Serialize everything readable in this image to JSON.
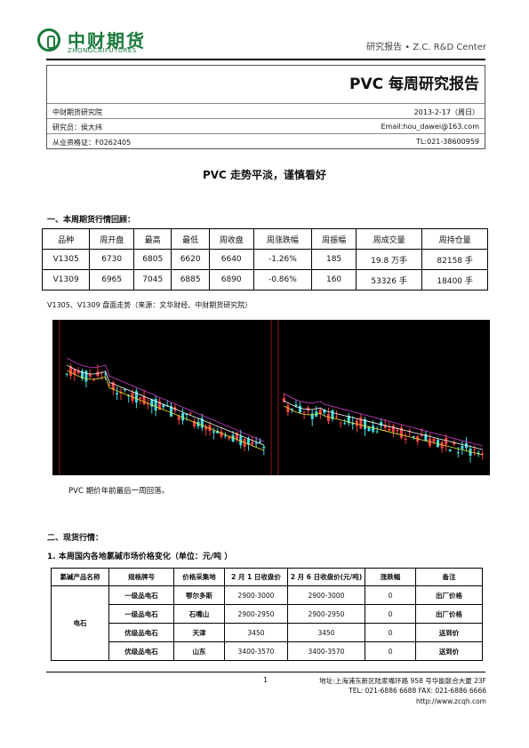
{
  "header": {
    "logo_cn": "中财期货",
    "logo_en": "ZHONGCAIFUTURES",
    "right_label": "研究报告 • Z.C. R&D Center"
  },
  "report_title": "PVC 每周研究报告",
  "info": {
    "institute": "中财期货研究院",
    "date": "2013-2-17（周日）",
    "researcher": "研究员：侯大纬",
    "email": "Email:hou_dawei@163.com",
    "license": "从业资格证：F0262405",
    "tel": "TL:021-38600959"
  },
  "subtitle": "PVC 走势平淡，谨慎看好",
  "section1": "一、本周期货行情回顾：",
  "futures_table": {
    "headers": [
      "品种",
      "周开盘",
      "最高",
      "最低",
      "周收盘",
      "周涨跌幅",
      "周振幅",
      "周成交量",
      "周持仓量"
    ],
    "rows": [
      [
        "V1305",
        "6730",
        "6805",
        "6620",
        "6640",
        "-1.26%",
        "185",
        "19.8 万手",
        "82158 手"
      ],
      [
        "V1309",
        "6965",
        "7045",
        "6885",
        "6890",
        "-0.86%",
        "160",
        "53326 手",
        "18400 手"
      ]
    ]
  },
  "chart_caption": "V1305、V1309 盘面走势（来源：文华财经、中财期货研究院）",
  "chart_note": "PVC 期价年前最后一周回落。",
  "section2": "二、现货行情：",
  "section2_sub": "1. 本周国内各地氯碱市场价格变化（单位：元/吨 ）",
  "spot_table": {
    "headers": [
      "氯碱产品名称",
      "规格牌号",
      "价格采集地",
      "2 月 1 日收盘价",
      "2 月 6 日收盘价(元/吨)",
      "涨跌幅",
      "备注"
    ],
    "product": "电石",
    "rows": [
      [
        "一级品电石",
        "鄂尔多斯",
        "2900-3000",
        "2900-3000",
        "0",
        "出厂价格"
      ],
      [
        "一级品电石",
        "石嘴山",
        "2900-2950",
        "2900-2950",
        "0",
        "出厂价格"
      ],
      [
        "优级品电石",
        "天津",
        "3450",
        "3450",
        "0",
        "送到价"
      ],
      [
        "优级品电石",
        "山东",
        "3400-3570",
        "3400-3570",
        "0",
        "送到价"
      ]
    ]
  },
  "footer": {
    "page": "1",
    "address": "地址:上海浦东新区陆家嘴环路 958 号华能联合大厦 23F",
    "phone": "TEL: 021-6886 6688 FAX: 021-6886 6666",
    "website": "http://www.zcqh.com"
  }
}
